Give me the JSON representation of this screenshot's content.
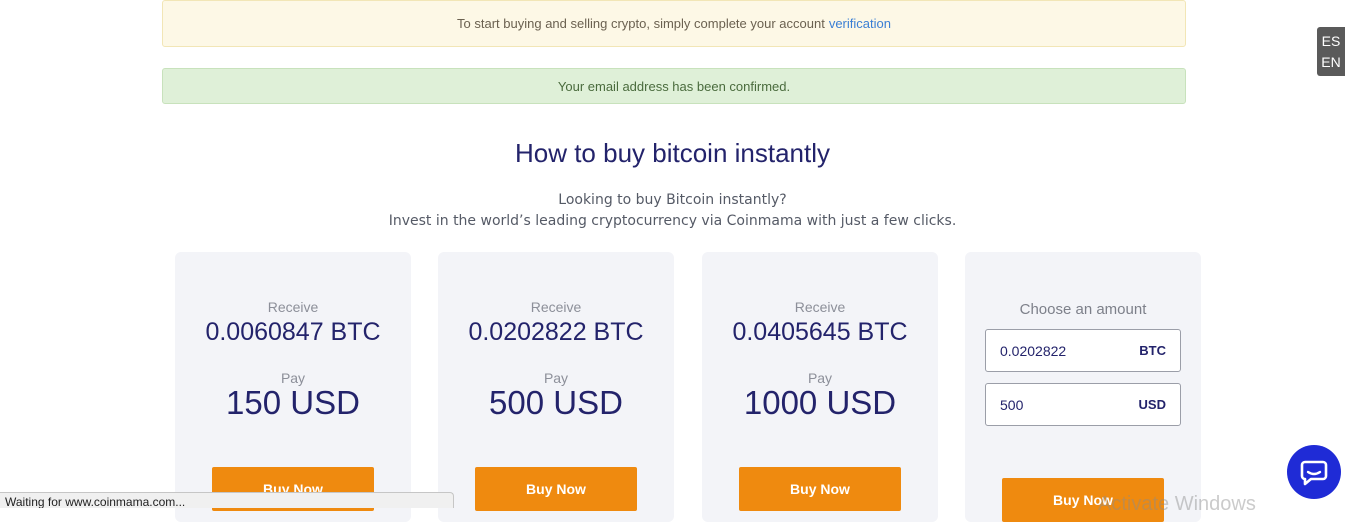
{
  "alerts": {
    "verify_text": "To start buying and selling crypto, simply complete your account",
    "verify_link": "verification",
    "confirmed_text": "Your email address has been confirmed."
  },
  "language": {
    "es": "ES",
    "en": "EN"
  },
  "hero": {
    "title": "How to buy bitcoin instantly",
    "line1": "Looking to buy Bitcoin instantly?",
    "line2": "Invest in the world’s leading cryptocurrency via Coinmama with just a few clicks."
  },
  "cards": [
    {
      "receive_label": "Receive",
      "btc": "0.0060847 BTC",
      "pay_label": "Pay",
      "usd": "150 USD",
      "button": "Buy Now"
    },
    {
      "receive_label": "Receive",
      "btc": "0.0202822 BTC",
      "pay_label": "Pay",
      "usd": "500 USD",
      "button": "Buy Now"
    },
    {
      "receive_label": "Receive",
      "btc": "0.0405645 BTC",
      "pay_label": "Pay",
      "usd": "1000 USD",
      "button": "Buy Now"
    }
  ],
  "custom": {
    "label": "Choose an amount",
    "btc_value": "0.0202822",
    "btc_unit": "BTC",
    "usd_value": "500",
    "usd_unit": "USD",
    "button": "Buy Now"
  },
  "status_bar": "Waiting for www.coinmama.com...",
  "watermark": "Activate Windows",
  "colors": {
    "accent": "#ef8a0f",
    "navy": "#23236b",
    "chat": "#1f2bd6"
  },
  "icons": {
    "chat": "chat-bubble-icon"
  }
}
